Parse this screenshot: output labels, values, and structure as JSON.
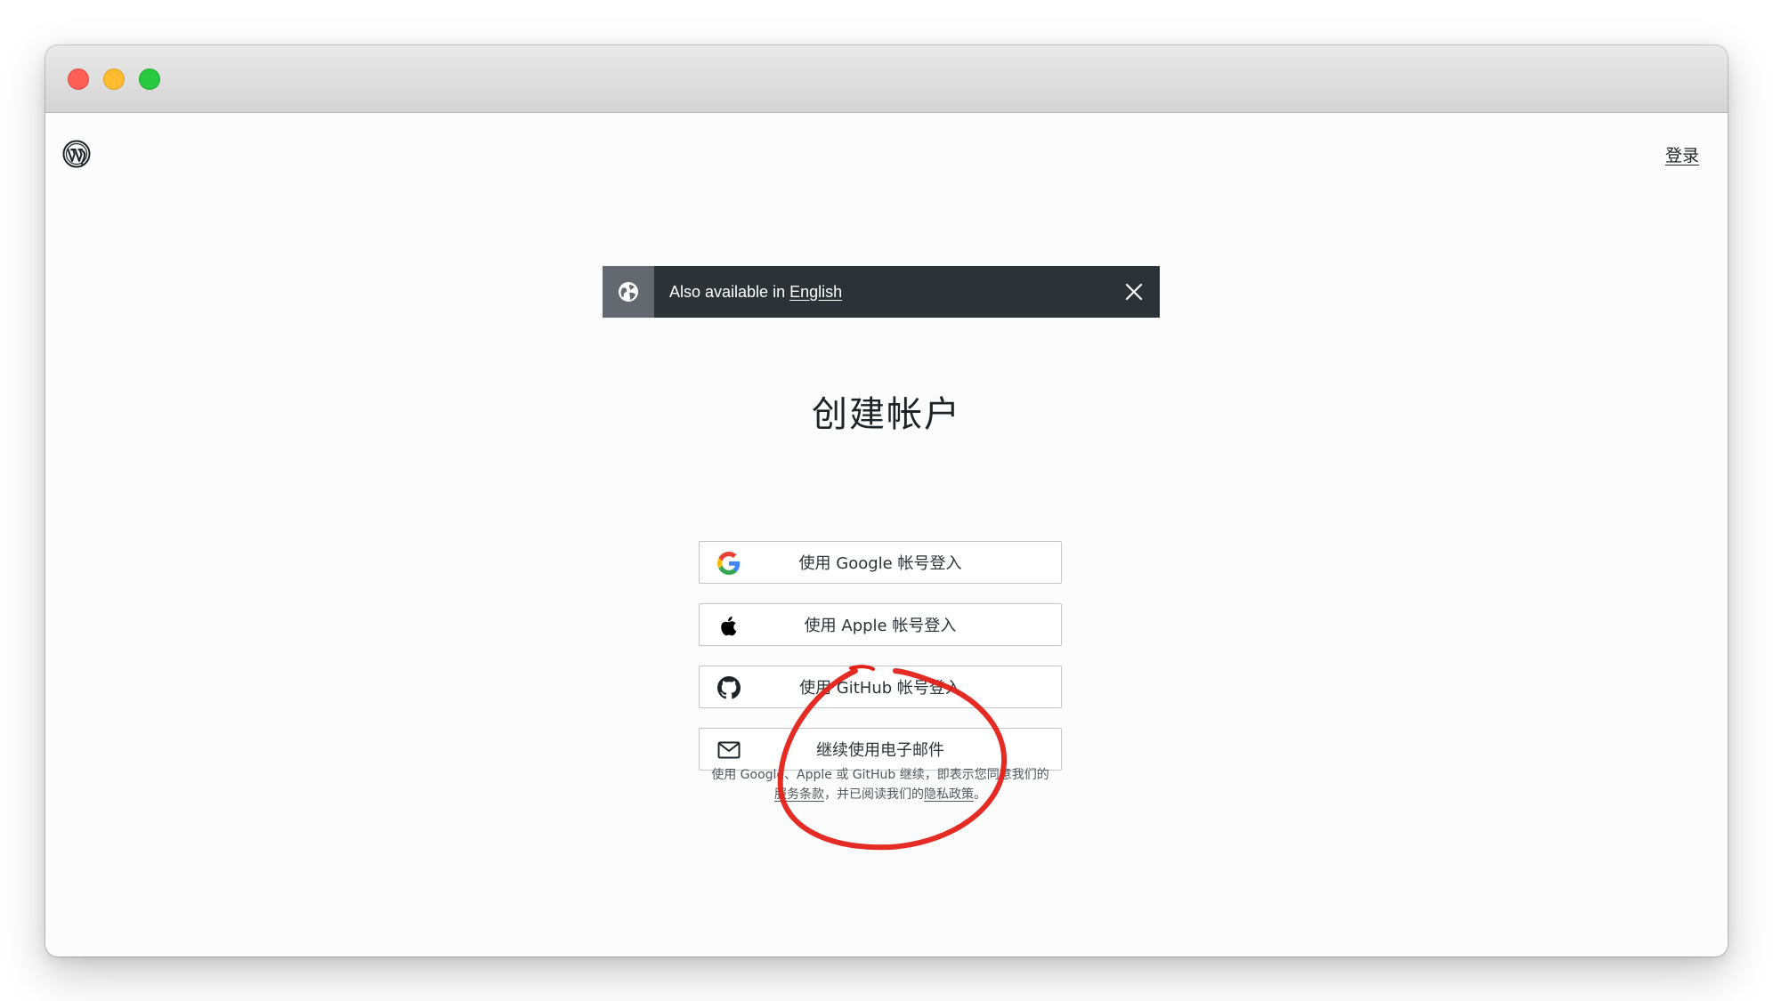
{
  "window": {
    "traffic_lights": [
      "close",
      "minimize",
      "zoom"
    ]
  },
  "header": {
    "logo_icon": "wordpress-logo-icon",
    "login_label": "登录"
  },
  "banner": {
    "icon": "globe-icon",
    "text_prefix": "Also available in ",
    "language_link": "English",
    "close_icon": "close-icon"
  },
  "main": {
    "title": "创建帐户",
    "buttons": [
      {
        "icon": "google-icon",
        "label": "使用 Google 帐号登入"
      },
      {
        "icon": "apple-icon",
        "label": "使用 Apple 帐号登入"
      },
      {
        "icon": "github-icon",
        "label": "使用 GitHub 帐号登入"
      },
      {
        "icon": "mail-icon",
        "label": "继续使用电子邮件"
      }
    ],
    "terms": {
      "line1": "使用 Google、Apple 或 GitHub 继续，即表示您同意我们的",
      "tos_link": "服务条款",
      "middle": "，并已阅读我们的",
      "privacy_link": "隐私政策",
      "end": "。"
    }
  },
  "colors": {
    "banner_bg": "#2c3338",
    "banner_icon_bg": "#646970",
    "annotation": "#e32119",
    "button_border": "#c3c4c7"
  }
}
